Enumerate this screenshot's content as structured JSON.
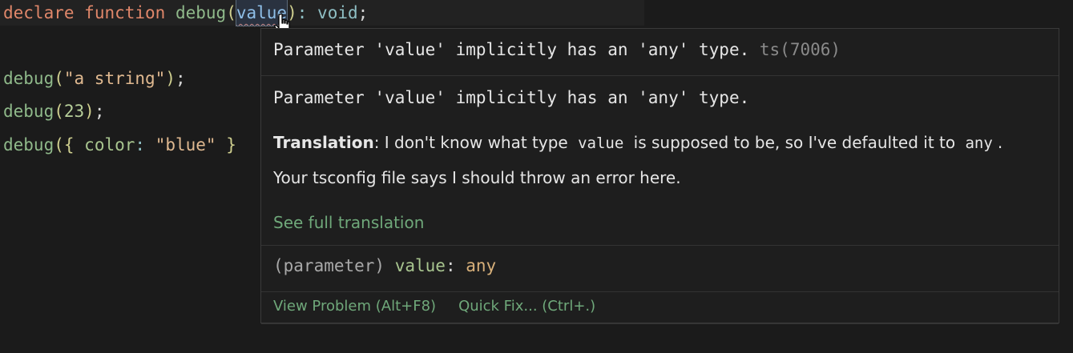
{
  "editor": {
    "line1": {
      "kw1": "declare",
      "kw2": "function",
      "fn": "debug",
      "open": "(",
      "param": "value",
      "close": ")",
      "colon": ":",
      "ret": "void",
      "semi": ";"
    },
    "line3": {
      "fn": "debug",
      "open": "(",
      "arg": "\"a string\"",
      "close": ")",
      "semi": ";"
    },
    "line4": {
      "fn": "debug",
      "open": "(",
      "arg": "23",
      "close": ")",
      "semi": ";"
    },
    "line5": {
      "fn": "debug",
      "open": "({",
      "prop": "color",
      "colon": ":",
      "str": "\"blue\"",
      "close": "}"
    }
  },
  "hover": {
    "diagnostic_message": "Parameter 'value' implicitly has an 'any' type.",
    "diagnostic_code": "ts(7006)",
    "detail_message": "Parameter 'value' implicitly has an 'any' type.",
    "translation_label": "Translation",
    "translation_part1": ": I don't know what type",
    "translation_code1": "value",
    "translation_part2": "is supposed to be, so I've defaulted it to",
    "translation_code2": "any",
    "translation_part3": ".",
    "translation_line2": "Your tsconfig file says I should throw an error here.",
    "see_full_link": "See full translation",
    "signature": {
      "kind": "(parameter)",
      "name": "value",
      "colon": ":",
      "type": "any"
    },
    "actions": {
      "view_problem": "View Problem (Alt+F8)",
      "quick_fix": "Quick Fix... (Ctrl+.)"
    }
  },
  "colors": {
    "keyword": "#e0876a",
    "function": "#8fb98a",
    "link": "#6fa87a",
    "background": "#1b1b1b"
  },
  "icons": {
    "cursor": "hand-pointer-icon"
  }
}
